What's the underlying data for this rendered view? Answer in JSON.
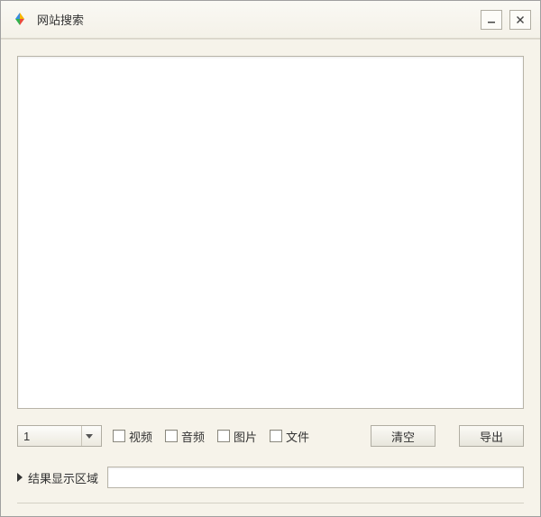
{
  "window": {
    "title": "网站搜索"
  },
  "input": {
    "value": ""
  },
  "select": {
    "value": "1"
  },
  "filters": {
    "video": "视频",
    "audio": "音频",
    "image": "图片",
    "file": "文件"
  },
  "buttons": {
    "clear": "清空",
    "export": "导出"
  },
  "result": {
    "label": "结果显示区域",
    "value": ""
  }
}
